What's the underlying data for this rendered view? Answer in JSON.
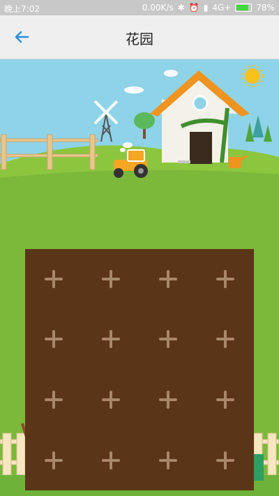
{
  "status": {
    "time": "晚上7:02",
    "speed": "0.00K/s",
    "network": "4G+",
    "battery": "78%"
  },
  "header": {
    "title": "花园",
    "back_icon": "arrow-left-icon"
  },
  "colors": {
    "accent": "#2d8ed8",
    "soil": "#5b3518",
    "grass": "#8cc63f",
    "sky": "#8fd3e8"
  },
  "garden": {
    "slot_icon": "plus-icon",
    "rows": 4,
    "cols": 4
  }
}
